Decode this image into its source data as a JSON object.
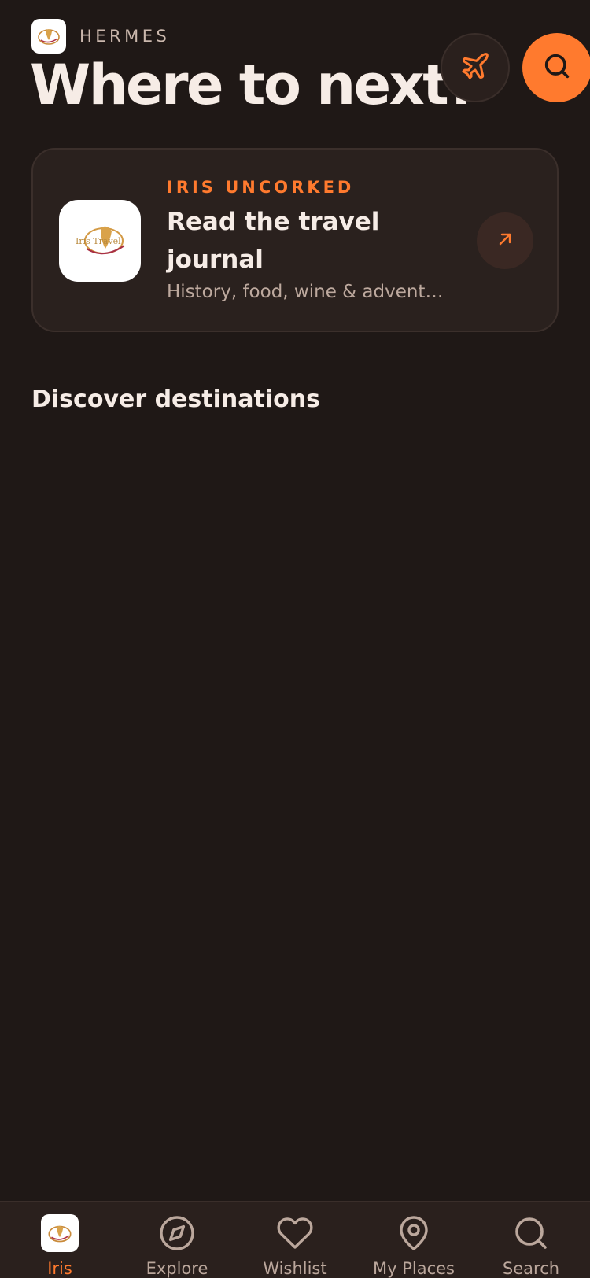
{
  "header": {
    "brand": "HERMES",
    "title": "Where to next?",
    "trip_button_icon": "airplane-icon",
    "search_button_icon": "search-icon"
  },
  "journal_card": {
    "eyebrow": "IRIS UNCORKED",
    "title": "Read the travel journal",
    "subtitle": "History, food, wine & adventures",
    "logo_icon": "iris-travel-logo",
    "logo_text": "Iris Travel",
    "arrow_icon": "arrow-up-right-icon"
  },
  "discover": {
    "title": "Discover destinations"
  },
  "bottom_nav": {
    "items": [
      {
        "label": "Iris",
        "icon": "iris-logo",
        "active": true
      },
      {
        "label": "Explore",
        "icon": "compass-icon",
        "active": false
      },
      {
        "label": "Wishlist",
        "icon": "heart-icon",
        "active": false
      },
      {
        "label": "My Places",
        "icon": "map-pin-icon",
        "active": false
      },
      {
        "label": "Search",
        "icon": "search-icon",
        "active": false
      }
    ]
  },
  "colors": {
    "background": "#1f1816",
    "accent": "#ff7a2e",
    "card": "#2a211e",
    "text": "#f6ece6",
    "muted": "#bda99e"
  }
}
